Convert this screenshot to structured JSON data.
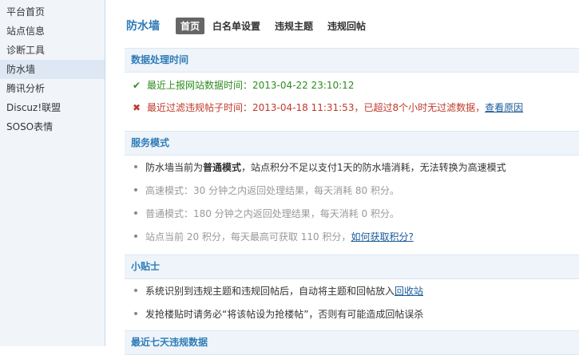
{
  "sidebar": {
    "items": [
      {
        "label": "平台首页"
      },
      {
        "label": "站点信息"
      },
      {
        "label": "诊断工具"
      },
      {
        "label": "防水墙"
      },
      {
        "label": "腾讯分析"
      },
      {
        "label": "Discuz!联盟"
      },
      {
        "label": "SOSO表情"
      }
    ]
  },
  "header": {
    "title": "防水墙",
    "tabs": [
      {
        "label": "首页"
      },
      {
        "label": "白名单设置"
      },
      {
        "label": "违规主题"
      },
      {
        "label": "违规回帖"
      }
    ]
  },
  "data_time": {
    "heading": "数据处理时间",
    "report_text": "最近上报网站数据时间：2013-04-22 23:10:12",
    "filter_text": "最近过滤违规帖子时间：2013-04-18 11:31:53，已超过8个小时无过滤数据，",
    "filter_link": "查看原因"
  },
  "service_mode": {
    "heading": "服务模式",
    "line1_prefix": "防水墙当前为",
    "line1_mode": "普通模式",
    "line1_suffix": "，站点积分不足以支付1天的防水墙消耗，无法转换为高速模式",
    "line2": "高速模式：30 分钟之内返回处理结果，每天消耗 80 积分。",
    "line3": "普通模式：180 分钟之内返回处理结果，每天消耗 0 积分。",
    "line4": "站点当前 20 积分，每天最高可获取 110 积分，",
    "line4_link": "如何获取积分?"
  },
  "tips": {
    "heading": "小贴士",
    "line1": "系统识别到违规主题和违规回帖后，自动将主题和回帖放入",
    "line1_link": "回收站",
    "line2": "发抢楼贴时请务必“将该帖设为抢楼帖”，否则有可能造成回帖误杀"
  },
  "recent": {
    "heading": "最近七天违规数据"
  }
}
